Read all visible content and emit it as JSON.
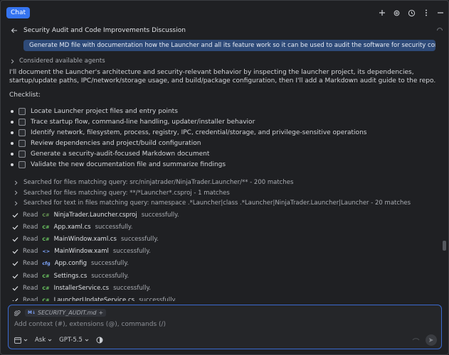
{
  "topbar": {
    "tab_label": "Chat"
  },
  "title": "Security Audit and Code Improvements Discussion",
  "prompt": "Generate MD file with documentation how the Launcher and all its feature work so it can be used to audit the software for security concerns.",
  "considered": "Considered available agents",
  "paragraph": "I'll document the Launcher's architecture and security-relevant behavior by inspecting the launcher project, its dependencies, startup/update paths, IPC/network/storage usage, and build/package configuration, then I'll add a Markdown audit guide to the repo.",
  "checklist_heading": "Checklist:",
  "checklist": [
    "Locate Launcher project files and entry points",
    "Trace startup flow, command-line handling, updater/installer behavior",
    "Identify network, filesystem, process, registry, IPC, credential/storage, and privilege-sensitive operations",
    "Review dependencies and project/build configuration",
    "Generate a security-audit-focused Markdown document",
    "Validate the new documentation file and summarize findings"
  ],
  "searches": [
    "Searched for files matching query: src/ninjatrader/NinjaTrader.Launcher/** - 200 matches",
    "Searched for files matching query: **/*Launcher*.csproj - 1 matches",
    "Searched for text in files matching query: namespace .*Launcher|class .*Launcher|NinjaTrader.Launcher|Launcher - 20 matches"
  ],
  "reads": [
    {
      "verb": "Read",
      "type": "C#",
      "type_color": "#6a9955",
      "file": "NinjaTrader.Launcher.csproj",
      "status": "successfully."
    },
    {
      "verb": "Read",
      "type": "C#",
      "type_color": "#6ecb63",
      "file": "App.xaml.cs",
      "status": "successfully."
    },
    {
      "verb": "Read",
      "type": "C#",
      "type_color": "#6ecb63",
      "file": "MainWindow.xaml.cs",
      "status": "successfully."
    },
    {
      "verb": "Read",
      "type": "<>",
      "type_color": "#7fa6ff",
      "file": "MainWindow.xaml",
      "status": "successfully."
    },
    {
      "verb": "Read",
      "type": "cfg",
      "type_color": "#7fa6ff",
      "file": "App.config",
      "status": "successfully."
    },
    {
      "verb": "Read",
      "type": "C#",
      "type_color": "#6ecb63",
      "file": "Settings.cs",
      "status": "successfully."
    },
    {
      "verb": "Read",
      "type": "C#",
      "type_color": "#6ecb63",
      "file": "InstallerService.cs",
      "status": "successfully."
    },
    {
      "verb": "Read",
      "type": "C#",
      "type_color": "#6ecb63",
      "file": "LauncherUpdateService.cs",
      "status": "successfully."
    }
  ],
  "composer": {
    "attachment_badge": "M↓",
    "attachment_name": "SECURITY_AUDIT.md",
    "attachment_add": "+",
    "placeholder": "Add context (#), extensions (@), commands (/)",
    "mode": "Ask",
    "model": "GPT-5.5"
  },
  "colors": {
    "accent": "#3574f0",
    "prompt_bg": "#2e4a78",
    "background": "#1f2023"
  }
}
